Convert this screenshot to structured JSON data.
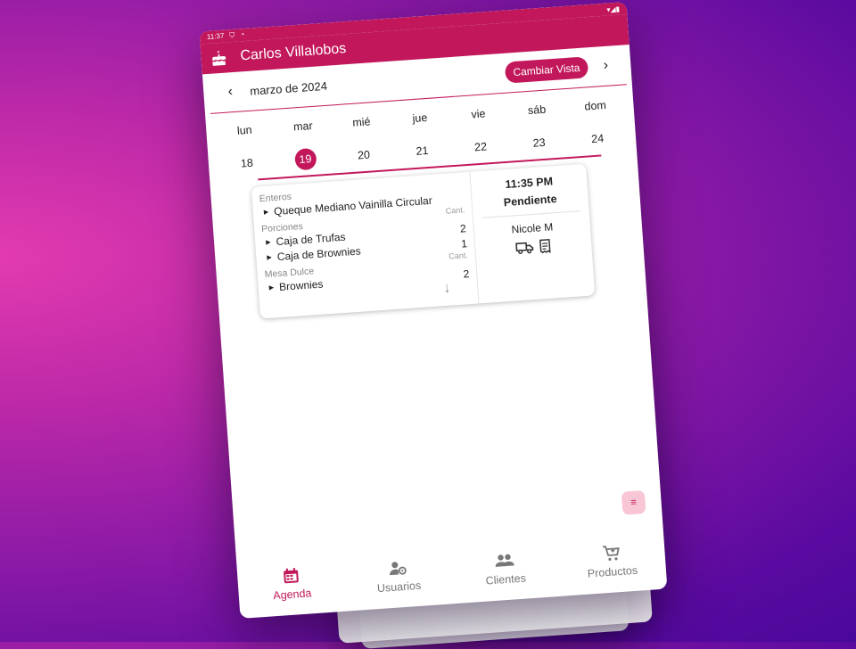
{
  "status_bar": {
    "time": "11:37"
  },
  "app_bar": {
    "title": "Carlos Villalobos",
    "icon": "cake-icon"
  },
  "calendar": {
    "month_label": "marzo de 2024",
    "change_view_label": "Cambiar Vista",
    "day_names": [
      "lun",
      "mar",
      "mié",
      "jue",
      "vie",
      "sáb",
      "dom"
    ],
    "dates": [
      "18",
      "19",
      "20",
      "21",
      "22",
      "23",
      "24"
    ],
    "selected_date": "19"
  },
  "order": {
    "groups": [
      {
        "title": "Enteros",
        "qty_header": "Cant.",
        "items": [
          {
            "name": "Queque Mediano Vainilla Circular",
            "qty": ""
          }
        ]
      },
      {
        "title": "Porciones",
        "qty_header": "",
        "items": [
          {
            "name": "Caja de Trufas",
            "qty": "2"
          },
          {
            "name": "Caja de Brownies",
            "qty": "1"
          }
        ]
      },
      {
        "title": "Mesa Dulce",
        "qty_header": "Cant.",
        "items": [
          {
            "name": "Brownies",
            "qty": "2"
          }
        ]
      }
    ],
    "time": "11:35 PM",
    "status": "Pendiente",
    "customer": "Nicole M",
    "icons": [
      "truck-icon",
      "receipt-icon"
    ]
  },
  "fab": {
    "icon": "menu-icon"
  },
  "bottom_nav": [
    {
      "label": "Agenda",
      "icon": "calendar-icon",
      "active": true
    },
    {
      "label": "Usuarios",
      "icon": "user-gear-icon",
      "active": false
    },
    {
      "label": "Clientes",
      "icon": "group-icon",
      "active": false
    },
    {
      "label": "Productos",
      "icon": "cart-icon",
      "active": false
    }
  ],
  "colors": {
    "primary": "#c2185b",
    "fab_bg": "#f8c6d5"
  }
}
